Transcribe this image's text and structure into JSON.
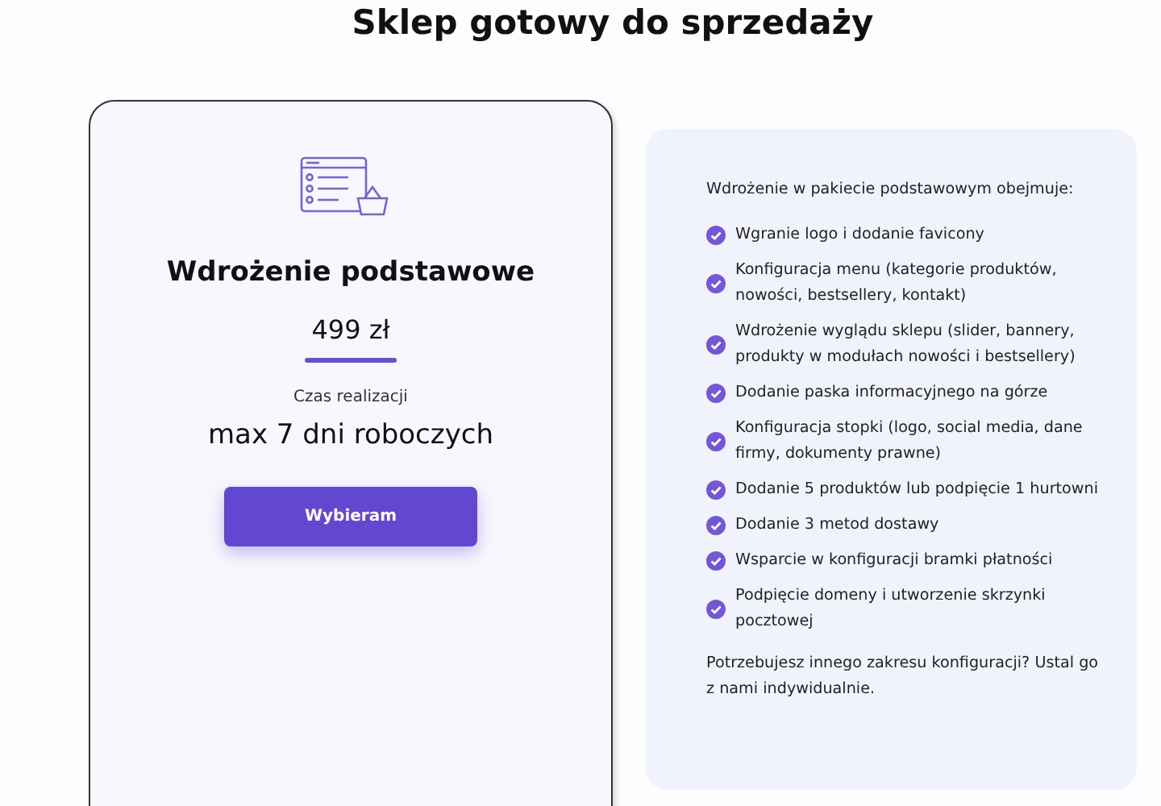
{
  "heading": "Sklep gotowy do sprzedaży",
  "plan": {
    "name": "Wdrożenie podstawowe",
    "price": "499 zł",
    "time_label": "Czas realizacji",
    "time": "max 7 dni roboczych",
    "button": "Wybieram"
  },
  "details": {
    "intro": "Wdrożenie w pakiecie podstawowym obejmuje:",
    "items": [
      "Wgranie logo i dodanie favicony",
      "Konfiguracja menu (kategorie produktów, nowości, bestsellery, kontakt)",
      "Wdrożenie wyglądu sklepu (slider, bannery, produkty w modułach nowości i bestsellery)",
      "Dodanie paska informacyjnego na górze",
      "Konfiguracja stopki (logo, social media, dane firmy, dokumenty prawne)",
      "Dodanie 5 produktów lub podpięcie 1 hurtowni",
      "Dodanie 3 metod dostawy",
      "Wsparcie w konfiguracji bramki płatności",
      "Podpięcie domeny i utworzenie skrzynki pocztowej"
    ],
    "footer": "Potrzebujesz innego zakresu konfiguracji? Ustal go z nami indywidualnie."
  }
}
